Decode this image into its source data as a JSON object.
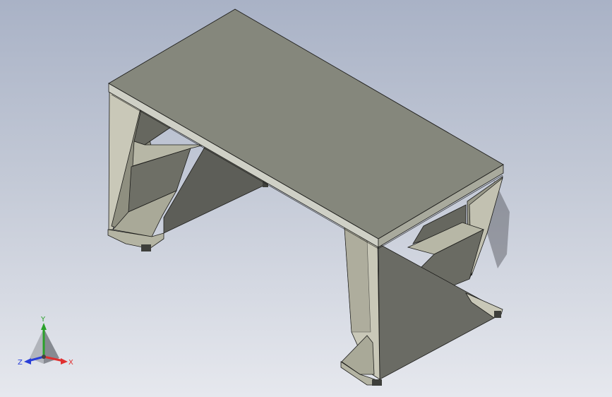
{
  "viewport": {
    "background_top": "#a9b2c6",
    "background_bottom": "#e6e8ee"
  },
  "model": {
    "type": "3d-isometric-table",
    "colors": {
      "top_face": "#85877c",
      "top_edge_front": "#cfd0c6",
      "panel_light": "#c9c8b8",
      "panel_mid": "#9a9a8a",
      "panel_dark": "#5d5e58",
      "interior_dark": "#66675f",
      "interior_light": "#b7b7a6",
      "foot": "#3e3f3b",
      "shadow": "#2a2c30",
      "edge_line": "#1c1c1a"
    }
  },
  "triad": {
    "x_label": "X",
    "y_label": "Y",
    "z_label": "Z",
    "x_color": "#e03030",
    "y_color": "#2aa12a",
    "z_color": "#2a3fd8"
  }
}
